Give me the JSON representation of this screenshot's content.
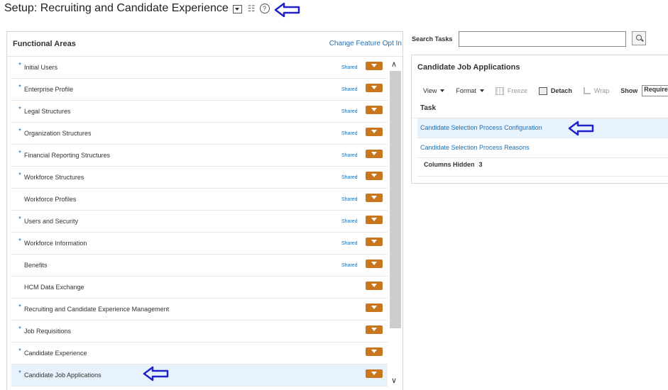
{
  "header": {
    "title": "Setup: Recruiting and Candidate Experience",
    "dropdown_icon": "chevron-down-icon",
    "tasks_icon": "task-list-icon",
    "help_icon": "help-icon",
    "help_glyph": "?",
    "tasks_glyph": "☷"
  },
  "functional_areas": {
    "title": "Functional Areas",
    "change_link": "Change Feature Opt In",
    "rows": [
      {
        "label": "Initial Users",
        "required": true,
        "shared": "Shared"
      },
      {
        "label": "Enterprise Profile",
        "required": true,
        "shared": "Shared"
      },
      {
        "label": "Legal Structures",
        "required": true,
        "shared": "Shared"
      },
      {
        "label": "Organization Structures",
        "required": true,
        "shared": "Shared"
      },
      {
        "label": "Financial Reporting Structures",
        "required": true,
        "shared": "Shared"
      },
      {
        "label": "Workforce Structures",
        "required": true,
        "shared": "Shared"
      },
      {
        "label": "Workforce Profiles",
        "required": false,
        "shared": "Shared"
      },
      {
        "label": "Users and Security",
        "required": true,
        "shared": "Shared"
      },
      {
        "label": "Workforce Information",
        "required": true,
        "shared": "Shared"
      },
      {
        "label": "Benefits",
        "required": false,
        "shared": "Shared"
      },
      {
        "label": "HCM Data Exchange",
        "required": false,
        "shared": ""
      },
      {
        "label": "Recruiting and Candidate Experience Management",
        "required": true,
        "shared": ""
      },
      {
        "label": "Job Requisitions",
        "required": true,
        "shared": ""
      },
      {
        "label": "Candidate Experience",
        "required": true,
        "shared": ""
      },
      {
        "label": "Candidate Job Applications",
        "required": true,
        "shared": "",
        "selected": true
      }
    ],
    "star": "*",
    "scroll_up": "∧",
    "scroll_down": "∨"
  },
  "search": {
    "label": "Search Tasks",
    "value": "",
    "button_icon": "search-icon"
  },
  "tasks_panel": {
    "title": "Candidate Job Applications",
    "toolbar": {
      "view": "View",
      "format": "Format",
      "freeze": "Freeze",
      "detach": "Detach",
      "wrap": "Wrap",
      "show": "Show",
      "show_value": "Required"
    },
    "column_header": "Task",
    "tasks": [
      "Candidate Selection Process Configuration",
      "Candidate Selection Process Reasons"
    ],
    "columns_hidden_label": "Columns Hidden",
    "columns_hidden_count": "3"
  },
  "colors": {
    "accent": "#1f6fb2",
    "dropdown_button": "#c8771f",
    "selected_row": "#e8f2fc",
    "annotation_arrow": "#2222cc"
  }
}
